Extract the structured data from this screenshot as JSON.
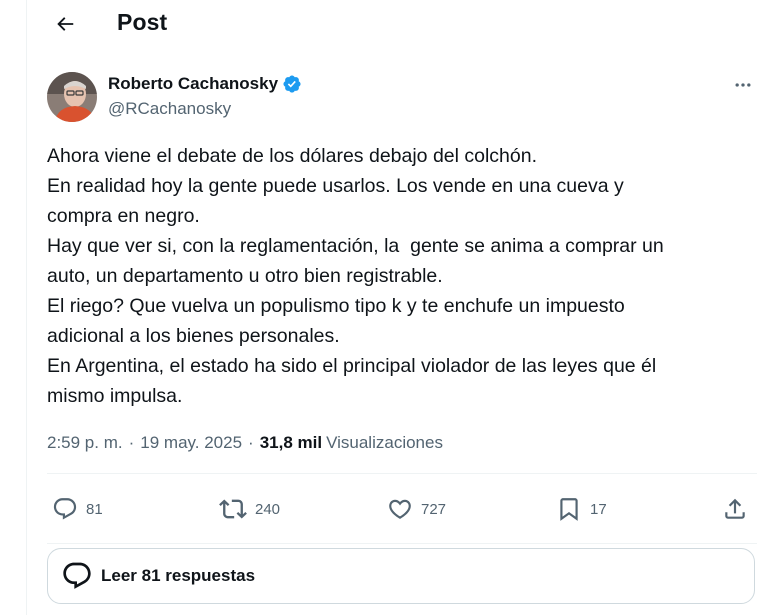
{
  "header": {
    "title": "Post",
    "back_icon": "arrow-left-icon"
  },
  "author": {
    "name": "Roberto Cachanosky",
    "handle": "@RCachanosky",
    "verified_icon": "verified-badge-icon",
    "verified_color": "#1d9bf0"
  },
  "tweet": {
    "lines": [
      "Ahora viene el debate de los dólares debajo del colchón.",
      "En realidad hoy la gente puede usarlos. Los vende en una cueva y",
      "compra en negro.",
      "Hay que ver si, con la reglamentación, la  gente se anima a comprar un",
      "auto, un departamento u otro bien registrable.",
      "El riego? Que vuelva un populismo tipo k y te enchufe un impuesto",
      "adicional a los bienes personales.",
      "En Argentina, el estado ha sido el principal violador de las leyes que él",
      "mismo impulsa."
    ]
  },
  "meta": {
    "time": "2:59 p. m.",
    "separator": "·",
    "date": "19 may. 2025",
    "views_count": "31,8 mil",
    "views_label": "Visualizaciones"
  },
  "actions": {
    "replies": "81",
    "reposts": "240",
    "likes": "727",
    "bookmarks": "17"
  },
  "replies_bar": {
    "label": "Leer 81 respuestas"
  },
  "colors": {
    "text": "#0f1419",
    "secondary": "#536471",
    "border": "#cfd9de",
    "divider": "#eff3f4"
  }
}
